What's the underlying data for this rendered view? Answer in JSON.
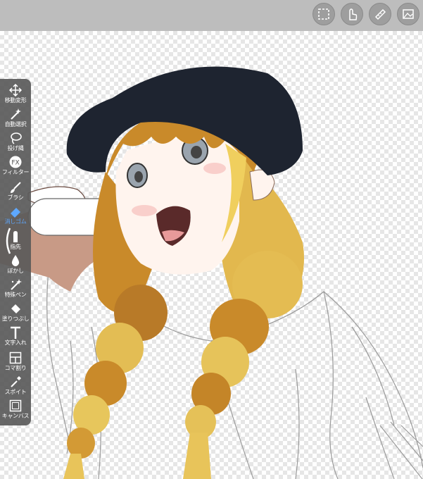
{
  "topbar": {
    "buttons": [
      {
        "name": "selection",
        "icon": "dashed-square-icon"
      },
      {
        "name": "hand-gesture",
        "icon": "hand-pointer-icon"
      },
      {
        "name": "ruler",
        "icon": "ruler-icon"
      },
      {
        "name": "layer",
        "icon": "image-layer-icon"
      }
    ]
  },
  "toolbar": {
    "active_color": "#5ea8ff",
    "tools": [
      {
        "label": "移動変形",
        "icon": "move-arrows-icon"
      },
      {
        "label": "自動選択",
        "icon": "magic-wand-icon"
      },
      {
        "label": "投げ縄",
        "icon": "lasso-icon"
      },
      {
        "label": "フィルター",
        "icon": "fx-icon"
      },
      {
        "label": "ブラシ",
        "icon": "brush-icon"
      },
      {
        "label": "消しゴム",
        "icon": "eraser-icon",
        "active": true
      },
      {
        "label": "指先",
        "icon": "finger-smudge-icon"
      },
      {
        "label": "ぼかし",
        "icon": "blur-drop-icon"
      },
      {
        "label": "特殊ペン",
        "icon": "special-pen-icon"
      },
      {
        "label": "塗りつぶし",
        "icon": "bucket-fill-icon"
      },
      {
        "label": "文字入れ",
        "icon": "text-T-icon"
      },
      {
        "label": "コマ割り",
        "icon": "panel-divide-icon"
      },
      {
        "label": "スポイト",
        "icon": "eyedropper-icon"
      },
      {
        "label": "キャンバス",
        "icon": "canvas-icon"
      }
    ]
  },
  "colors": {
    "topbar": "#bdbdbd",
    "cap": "#1e2430",
    "hair": "#e8c45a",
    "hair_shadow": "#a0601e",
    "skin": "#fff4ee",
    "arm": "#c89a86"
  }
}
